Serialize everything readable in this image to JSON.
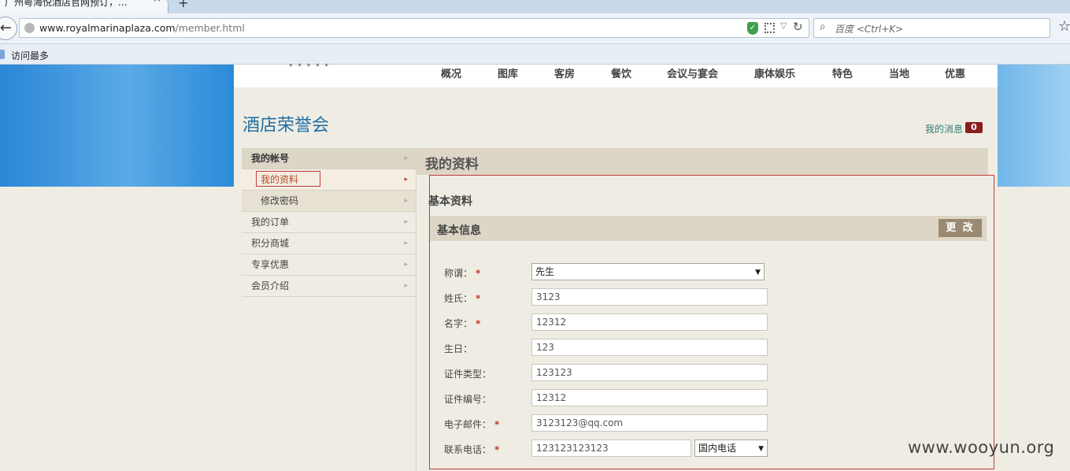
{
  "browser": {
    "tab_title": "广州粤海悦酒店官网预订，...",
    "tab_close": "×",
    "tab_new": "+",
    "url_domain": "www.royalmarinaplaza.com",
    "url_path": "/member.html",
    "search_placeholder": "百度 <Ctrl+K>",
    "bookmark": "访问最多"
  },
  "site": {
    "stars": "* * * * *",
    "nav": [
      "概况",
      "图库",
      "客房",
      "餐饮",
      "会议与宴会",
      "康体娱乐",
      "特色",
      "当地",
      "优惠"
    ],
    "club_title": "酒店荣誉会",
    "messages_label": "我的消息",
    "messages_count": "0"
  },
  "sidebar": {
    "items": [
      {
        "label": "我的帐号"
      },
      {
        "label": "我的资料"
      },
      {
        "label": "修改密码"
      },
      {
        "label": "我的订单"
      },
      {
        "label": "积分商城"
      },
      {
        "label": "专享优惠"
      },
      {
        "label": "会员介绍"
      }
    ]
  },
  "main": {
    "title": "我的资料",
    "section_title": "基本资料",
    "info_title": "基本信息",
    "edit_label": "更 改",
    "required_mark": "*",
    "fields": [
      {
        "label": "称谓：",
        "value": "先生",
        "required": true
      },
      {
        "label": "姓氏：",
        "value": "3123",
        "required": true
      },
      {
        "label": "名字：",
        "value": "12312",
        "required": true
      },
      {
        "label": "生日：",
        "value": "123",
        "required": false
      },
      {
        "label": "证件类型：",
        "value": "123123",
        "required": false
      },
      {
        "label": "证件编号：",
        "value": "12312",
        "required": false
      },
      {
        "label": "电子邮件：",
        "value": "3123123@qq.com",
        "required": true
      },
      {
        "label": "联系电话：",
        "value": "123123123123",
        "required": true
      }
    ],
    "phone_type": "国内电话"
  },
  "watermark": "www.wooyun.org"
}
